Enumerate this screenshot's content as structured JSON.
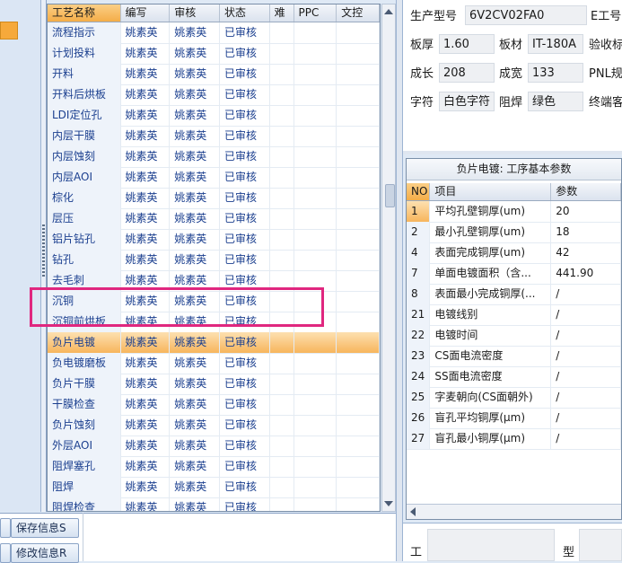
{
  "grid": {
    "columns": [
      "工艺名称",
      "编写",
      "审核",
      "状态",
      "难",
      "PPC",
      "文控"
    ],
    "rows": [
      {
        "name": "流程指示",
        "writer": "姚素英",
        "reviewer": "姚素英",
        "status": "已审核"
      },
      {
        "name": "计划投料",
        "writer": "姚素英",
        "reviewer": "姚素英",
        "status": "已审核"
      },
      {
        "name": "开料",
        "writer": "姚素英",
        "reviewer": "姚素英",
        "status": "已审核"
      },
      {
        "name": "开料后烘板",
        "writer": "姚素英",
        "reviewer": "姚素英",
        "status": "已审核"
      },
      {
        "name": "LDI定位孔",
        "writer": "姚素英",
        "reviewer": "姚素英",
        "status": "已审核"
      },
      {
        "name": "内层干膜",
        "writer": "姚素英",
        "reviewer": "姚素英",
        "status": "已审核"
      },
      {
        "name": "内层蚀刻",
        "writer": "姚素英",
        "reviewer": "姚素英",
        "status": "已审核"
      },
      {
        "name": "内层AOI",
        "writer": "姚素英",
        "reviewer": "姚素英",
        "status": "已审核"
      },
      {
        "name": "棕化",
        "writer": "姚素英",
        "reviewer": "姚素英",
        "status": "已审核"
      },
      {
        "name": "层压",
        "writer": "姚素英",
        "reviewer": "姚素英",
        "status": "已审核"
      },
      {
        "name": "铝片钻孔",
        "writer": "姚素英",
        "reviewer": "姚素英",
        "status": "已审核"
      },
      {
        "name": "钻孔",
        "writer": "姚素英",
        "reviewer": "姚素英",
        "status": "已审核"
      },
      {
        "name": "去毛刺",
        "writer": "姚素英",
        "reviewer": "姚素英",
        "status": "已审核"
      },
      {
        "name": "沉铜",
        "writer": "姚素英",
        "reviewer": "姚素英",
        "status": "已审核"
      },
      {
        "name": "沉铜前烘板",
        "writer": "姚素英",
        "reviewer": "姚素英",
        "status": "已审核"
      },
      {
        "name": "负片电镀",
        "writer": "姚素英",
        "reviewer": "姚素英",
        "status": "已审核"
      },
      {
        "name": "负电镀磨板",
        "writer": "姚素英",
        "reviewer": "姚素英",
        "status": "已审核"
      },
      {
        "name": "负片干膜",
        "writer": "姚素英",
        "reviewer": "姚素英",
        "status": "已审核"
      },
      {
        "name": "干膜检查",
        "writer": "姚素英",
        "reviewer": "姚素英",
        "status": "已审核"
      },
      {
        "name": "负片蚀刻",
        "writer": "姚素英",
        "reviewer": "姚素英",
        "status": "已审核"
      },
      {
        "name": "外层AOI",
        "writer": "姚素英",
        "reviewer": "姚素英",
        "status": "已审核"
      },
      {
        "name": "阻焊塞孔",
        "writer": "姚素英",
        "reviewer": "姚素英",
        "status": "已审核"
      },
      {
        "name": "阻焊",
        "writer": "姚素英",
        "reviewer": "姚素英",
        "status": "已审核"
      },
      {
        "name": "阻焊检查",
        "writer": "姚素英",
        "reviewer": "姚素英",
        "status": "已审核"
      }
    ],
    "selected_row": "负片电镀"
  },
  "buttons": {
    "save": "保存信息S",
    "modify": "修改信息R"
  },
  "info": {
    "model_label": "生产型号",
    "model_value": "6V2CV02FA0",
    "e_label": "E工号",
    "thickness_label": "板厚",
    "thickness_value": "1.60",
    "material_label": "板材",
    "material_value": "IT-180A",
    "verify_label": "验收标",
    "length_label": "成长",
    "length_value": "208",
    "width_label": "成宽",
    "width_value": "133",
    "pnl_label": "PNL规",
    "char_label": "字符",
    "char_value": "白色字符",
    "mask_label": "阻焊",
    "mask_value": "绿色",
    "terminal_label": "终端客"
  },
  "param": {
    "title": "负片电镀: 工序基本参数",
    "columns": [
      "NO",
      "项目",
      "参数"
    ],
    "rows": [
      {
        "no": "1",
        "item": "平均孔壁铜厚(um)",
        "value": "20"
      },
      {
        "no": "2",
        "item": "最小孔壁铜厚(um)",
        "value": "18"
      },
      {
        "no": "4",
        "item": "表面完成铜厚(um)",
        "value": "42"
      },
      {
        "no": "7",
        "item": "单面电镀面积（含...",
        "value": "441.90"
      },
      {
        "no": "8",
        "item": "表面最小完成铜厚(...",
        "value": "/"
      },
      {
        "no": "21",
        "item": "电镀线别",
        "value": "/"
      },
      {
        "no": "22",
        "item": "电镀时间",
        "value": "/"
      },
      {
        "no": "23",
        "item": "CS面电流密度",
        "value": "/"
      },
      {
        "no": "24",
        "item": "SS面电流密度",
        "value": "/"
      },
      {
        "no": "25",
        "item": "字麦朝向(CS面朝外)",
        "value": "/"
      },
      {
        "no": "26",
        "item": "盲孔平均铜厚(μm)",
        "value": "/"
      },
      {
        "no": "27",
        "item": "盲孔最小铜厚(μm)",
        "value": "/"
      }
    ]
  },
  "bottom_right": {
    "label1": "工",
    "label2": "型"
  }
}
